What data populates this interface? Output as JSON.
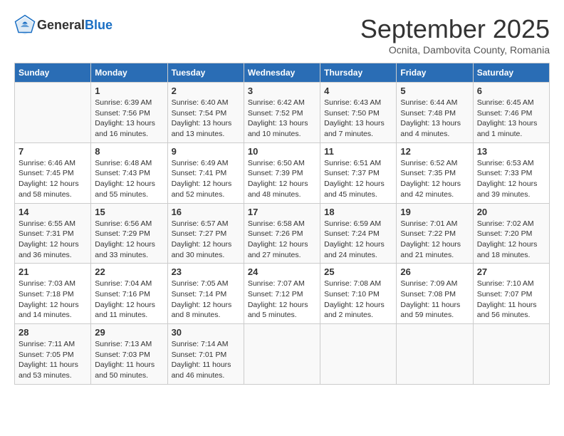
{
  "header": {
    "logo_general": "General",
    "logo_blue": "Blue",
    "month_title": "September 2025",
    "subtitle": "Ocnita, Dambovita County, Romania"
  },
  "days_of_week": [
    "Sunday",
    "Monday",
    "Tuesday",
    "Wednesday",
    "Thursday",
    "Friday",
    "Saturday"
  ],
  "weeks": [
    [
      {
        "day": "",
        "info": ""
      },
      {
        "day": "1",
        "info": "Sunrise: 6:39 AM\nSunset: 7:56 PM\nDaylight: 13 hours\nand 16 minutes."
      },
      {
        "day": "2",
        "info": "Sunrise: 6:40 AM\nSunset: 7:54 PM\nDaylight: 13 hours\nand 13 minutes."
      },
      {
        "day": "3",
        "info": "Sunrise: 6:42 AM\nSunset: 7:52 PM\nDaylight: 13 hours\nand 10 minutes."
      },
      {
        "day": "4",
        "info": "Sunrise: 6:43 AM\nSunset: 7:50 PM\nDaylight: 13 hours\nand 7 minutes."
      },
      {
        "day": "5",
        "info": "Sunrise: 6:44 AM\nSunset: 7:48 PM\nDaylight: 13 hours\nand 4 minutes."
      },
      {
        "day": "6",
        "info": "Sunrise: 6:45 AM\nSunset: 7:46 PM\nDaylight: 13 hours\nand 1 minute."
      }
    ],
    [
      {
        "day": "7",
        "info": "Sunrise: 6:46 AM\nSunset: 7:45 PM\nDaylight: 12 hours\nand 58 minutes."
      },
      {
        "day": "8",
        "info": "Sunrise: 6:48 AM\nSunset: 7:43 PM\nDaylight: 12 hours\nand 55 minutes."
      },
      {
        "day": "9",
        "info": "Sunrise: 6:49 AM\nSunset: 7:41 PM\nDaylight: 12 hours\nand 52 minutes."
      },
      {
        "day": "10",
        "info": "Sunrise: 6:50 AM\nSunset: 7:39 PM\nDaylight: 12 hours\nand 48 minutes."
      },
      {
        "day": "11",
        "info": "Sunrise: 6:51 AM\nSunset: 7:37 PM\nDaylight: 12 hours\nand 45 minutes."
      },
      {
        "day": "12",
        "info": "Sunrise: 6:52 AM\nSunset: 7:35 PM\nDaylight: 12 hours\nand 42 minutes."
      },
      {
        "day": "13",
        "info": "Sunrise: 6:53 AM\nSunset: 7:33 PM\nDaylight: 12 hours\nand 39 minutes."
      }
    ],
    [
      {
        "day": "14",
        "info": "Sunrise: 6:55 AM\nSunset: 7:31 PM\nDaylight: 12 hours\nand 36 minutes."
      },
      {
        "day": "15",
        "info": "Sunrise: 6:56 AM\nSunset: 7:29 PM\nDaylight: 12 hours\nand 33 minutes."
      },
      {
        "day": "16",
        "info": "Sunrise: 6:57 AM\nSunset: 7:27 PM\nDaylight: 12 hours\nand 30 minutes."
      },
      {
        "day": "17",
        "info": "Sunrise: 6:58 AM\nSunset: 7:26 PM\nDaylight: 12 hours\nand 27 minutes."
      },
      {
        "day": "18",
        "info": "Sunrise: 6:59 AM\nSunset: 7:24 PM\nDaylight: 12 hours\nand 24 minutes."
      },
      {
        "day": "19",
        "info": "Sunrise: 7:01 AM\nSunset: 7:22 PM\nDaylight: 12 hours\nand 21 minutes."
      },
      {
        "day": "20",
        "info": "Sunrise: 7:02 AM\nSunset: 7:20 PM\nDaylight: 12 hours\nand 18 minutes."
      }
    ],
    [
      {
        "day": "21",
        "info": "Sunrise: 7:03 AM\nSunset: 7:18 PM\nDaylight: 12 hours\nand 14 minutes."
      },
      {
        "day": "22",
        "info": "Sunrise: 7:04 AM\nSunset: 7:16 PM\nDaylight: 12 hours\nand 11 minutes."
      },
      {
        "day": "23",
        "info": "Sunrise: 7:05 AM\nSunset: 7:14 PM\nDaylight: 12 hours\nand 8 minutes."
      },
      {
        "day": "24",
        "info": "Sunrise: 7:07 AM\nSunset: 7:12 PM\nDaylight: 12 hours\nand 5 minutes."
      },
      {
        "day": "25",
        "info": "Sunrise: 7:08 AM\nSunset: 7:10 PM\nDaylight: 12 hours\nand 2 minutes."
      },
      {
        "day": "26",
        "info": "Sunrise: 7:09 AM\nSunset: 7:08 PM\nDaylight: 11 hours\nand 59 minutes."
      },
      {
        "day": "27",
        "info": "Sunrise: 7:10 AM\nSunset: 7:07 PM\nDaylight: 11 hours\nand 56 minutes."
      }
    ],
    [
      {
        "day": "28",
        "info": "Sunrise: 7:11 AM\nSunset: 7:05 PM\nDaylight: 11 hours\nand 53 minutes."
      },
      {
        "day": "29",
        "info": "Sunrise: 7:13 AM\nSunset: 7:03 PM\nDaylight: 11 hours\nand 50 minutes."
      },
      {
        "day": "30",
        "info": "Sunrise: 7:14 AM\nSunset: 7:01 PM\nDaylight: 11 hours\nand 46 minutes."
      },
      {
        "day": "",
        "info": ""
      },
      {
        "day": "",
        "info": ""
      },
      {
        "day": "",
        "info": ""
      },
      {
        "day": "",
        "info": ""
      }
    ]
  ]
}
